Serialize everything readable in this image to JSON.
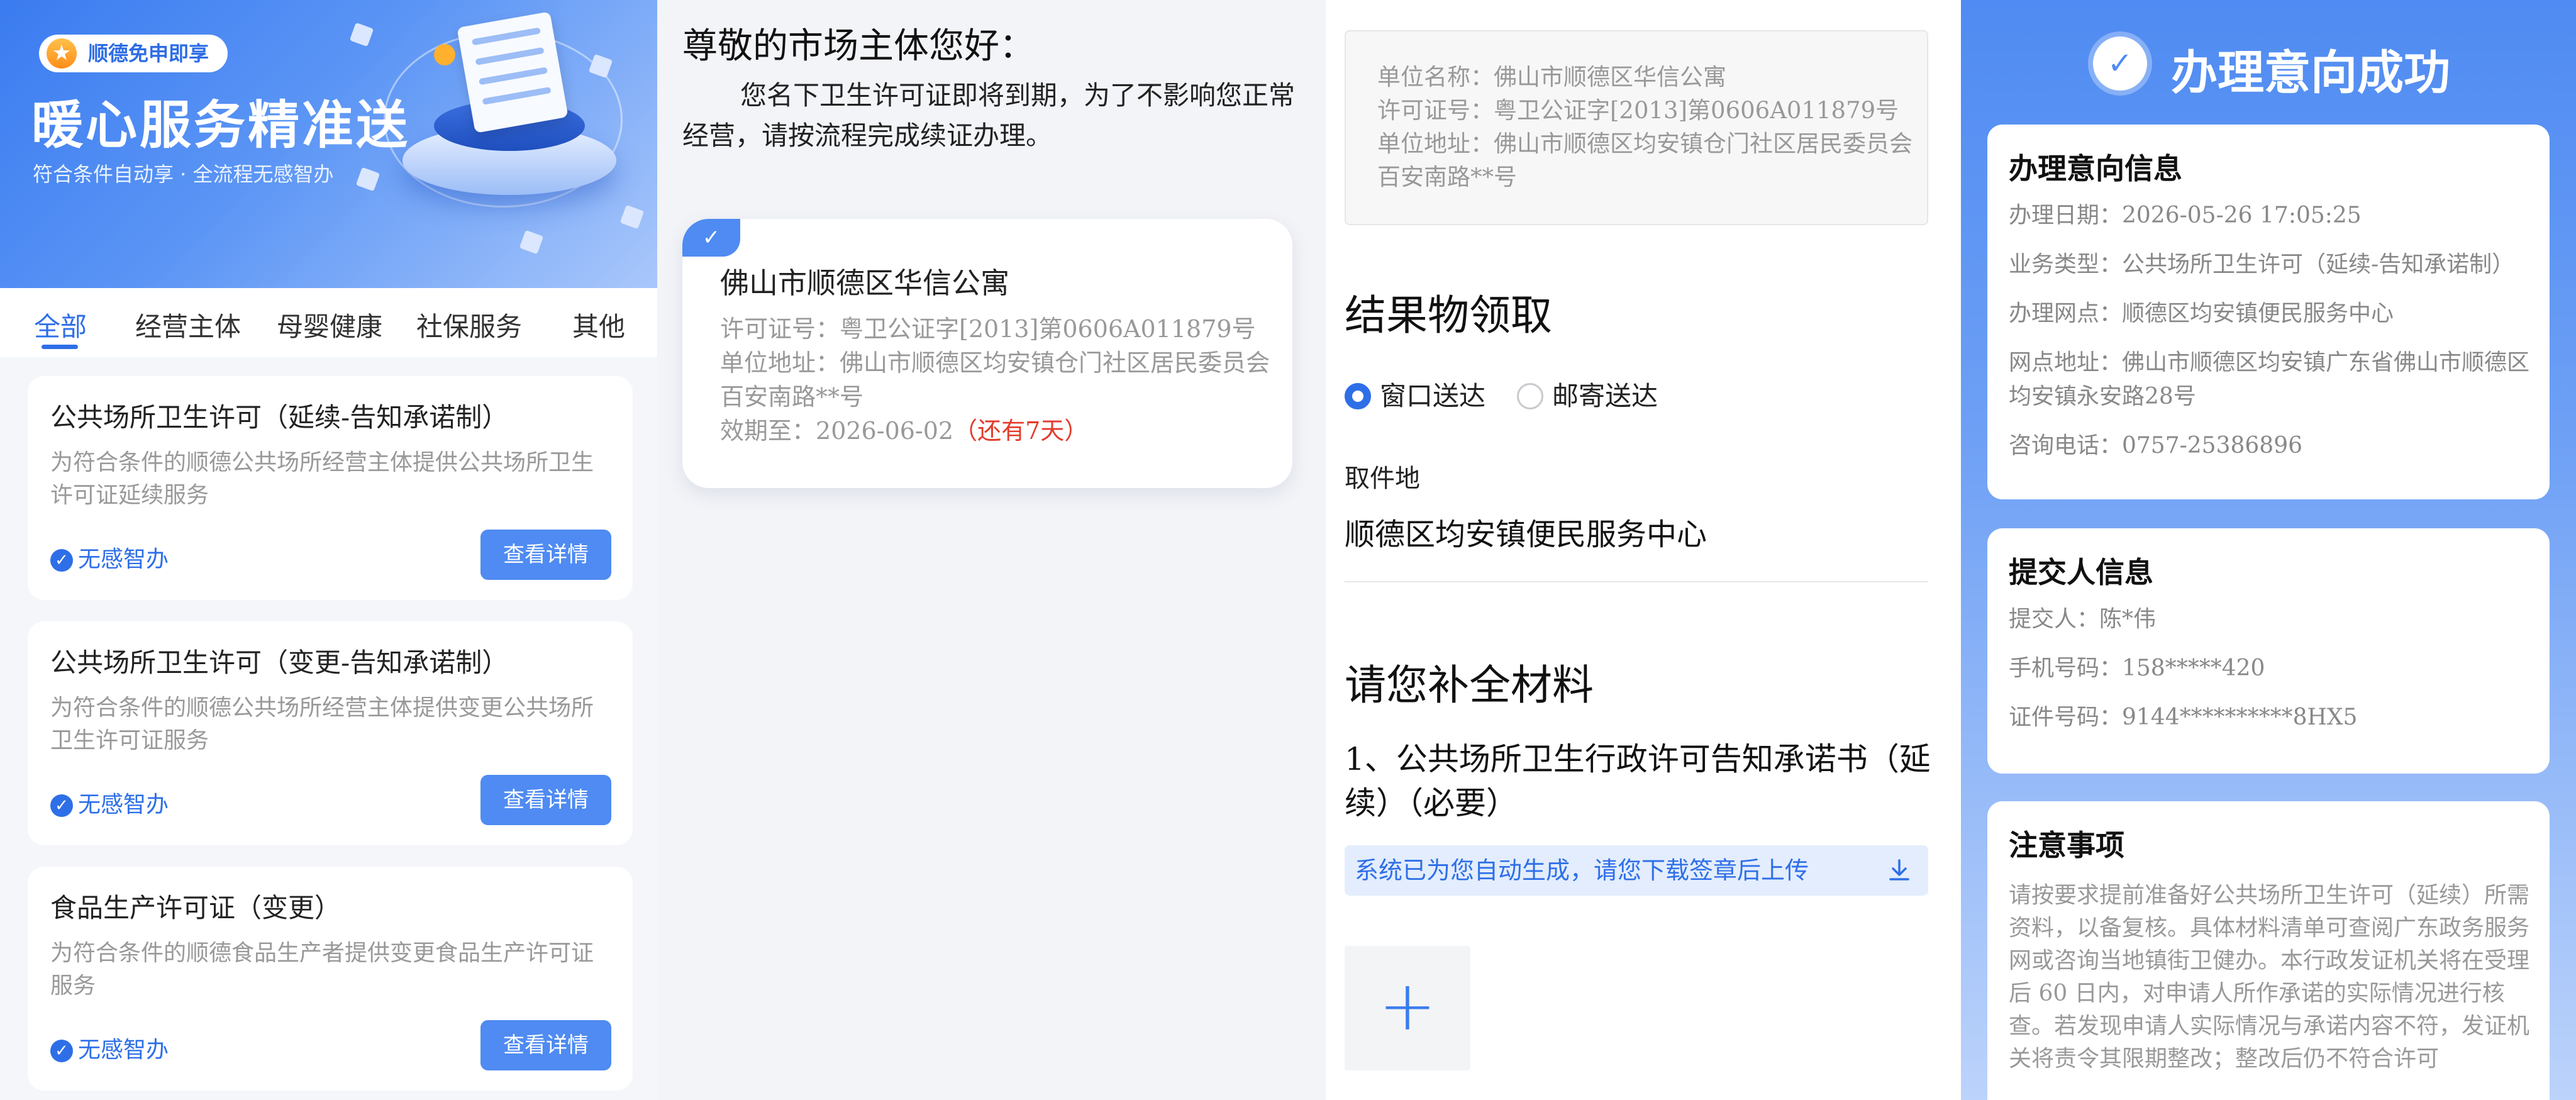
{
  "panel1": {
    "banner": {
      "pill": "顺德免申即享",
      "star_icon": "★",
      "title": "暖心服务精准送",
      "subtitle": "符合条件自动享 · 全流程无感智办"
    },
    "tabs": [
      "全部",
      "经营主体",
      "母婴健康",
      "社保服务",
      "其他"
    ],
    "active_tab": "全部",
    "services": [
      {
        "title": "公共场所卫生许可（延续-告知承诺制）",
        "desc": "为符合条件的顺德公共场所经营主体提供公共场所卫生许可证延续服务",
        "tag": "无感智办",
        "button": "查看详情"
      },
      {
        "title": "公共场所卫生许可（变更-告知承诺制）",
        "desc": "为符合条件的顺德公共场所经营主体提供变更公共场所卫生许可证服务",
        "tag": "无感智办",
        "button": "查看详情"
      },
      {
        "title": "食品生产许可证（变更）",
        "desc": "为符合条件的顺德食品生产者提供变更食品生产许可证服务",
        "tag": "无感智办",
        "button": "查看详情"
      }
    ]
  },
  "panel2": {
    "greeting": "尊敬的市场主体您好：",
    "notice": "您名下卫生许可证即将到期，为了不影响您正常经营，请按流程完成续证办理。",
    "entity": {
      "name": "佛山市顺德区华信公寓",
      "license_label": "许可证号：",
      "license": "粤卫公证字[2013]第0606A011879号",
      "address_label": "单位地址：",
      "address": "佛山市顺德区均安镇仓门社区居民委员会百安南路**号",
      "expiry_label": "效期至：",
      "expiry": "2026-06-02",
      "remaining": "（还有7天）"
    }
  },
  "panel3": {
    "info": {
      "name": "单位名称：佛山市顺德区华信公寓",
      "license": "许可证号：粤卫公证字[2013]第0606A011879号",
      "address": "单位地址：佛山市顺德区均安镇仓门社区居民委员会百安南路**号"
    },
    "result_title": "结果物领取",
    "delivery_options": [
      "窗口送达",
      "邮寄送达"
    ],
    "delivery_selected": "窗口送达",
    "pickup_label": "取件地",
    "pickup_value": "顺德区均安镇便民服务中心",
    "materials_title": "请您补全材料",
    "material_item": "1、公共场所卫生行政许可告知承诺书（延续）（必要）",
    "auto_tip": "系统已为您自动生成，请您下载签章后上传",
    "upload_icon": "+"
  },
  "panel4": {
    "title": "办理意向成功",
    "intent": {
      "title": "办理意向信息",
      "date": "办理日期：2026-05-26 17:05:25",
      "type": "业务类型：公共场所卫生许可（延续-告知承诺制）",
      "site": "办理网点：顺德区均安镇便民服务中心",
      "site_address": "网点地址：佛山市顺德区均安镇广东省佛山市顺德区均安镇永安路28号",
      "phone": "咨询电话：0757-25386896"
    },
    "submitter": {
      "title": "提交人信息",
      "name": "提交人：陈*伟",
      "phone": "手机号码：158*****420",
      "id": "证件号码：9144**********8HX5"
    },
    "notes": {
      "title": "注意事项",
      "text": "请按要求提前准备好公共场所卫生许可（延续）所需资料，以备复核。具体材料清单可查阅广东政务服务网或咨询当地镇街卫健办。本行政发证机关将在受理后 60 日内，对申请人所作承诺的实际情况进行核查。若发现申请人实际情况与承诺内容不符，发证机关将责令其限期整改；整改后仍不符合许可"
    }
  },
  "colors": {
    "accent": "#2e6fe8",
    "warning": "#e33b2c",
    "success_bg": "#4f8bf2"
  }
}
